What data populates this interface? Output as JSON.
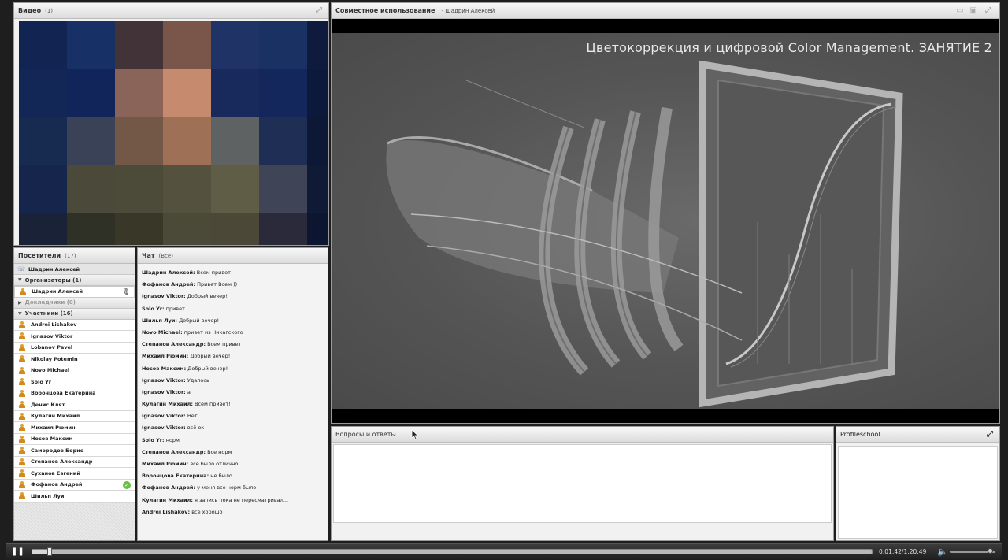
{
  "video": {
    "title": "Видео",
    "count": "(1)",
    "pixels": [
      [
        "#112452",
        "#173066",
        "#413338",
        "#79554a",
        "#1f3366",
        "#1a3163",
        "#0f1b3c"
      ],
      [
        "#132757",
        "#12255a",
        "#8a6458",
        "#c68a6f",
        "#18295b",
        "#13275c",
        "#0d193a"
      ],
      [
        "#172a50",
        "#394256",
        "#735848",
        "#9e7156",
        "#5f6262",
        "#1e2e55",
        "#0c1836"
      ],
      [
        "#16254b",
        "#4b4a3a",
        "#4c4b39",
        "#54523f",
        "#5f5d46",
        "#3f4556",
        "#0e1a36"
      ],
      [
        "#1a2237",
        "#2f3127",
        "#383728",
        "#4b4938",
        "#4c4838",
        "#2a2a3a",
        "#0d1630"
      ]
    ]
  },
  "attendees": {
    "title": "Посетители",
    "count": "(17)",
    "presenter": "Шадрин Алексей",
    "groups": {
      "hosts": "Организаторы (1)",
      "presenters": "Докладчики (0)",
      "participants": "Участники (16)"
    },
    "host_name": "Шадрин Алексей",
    "participants": [
      "Andrei Lishakov",
      "Ignasov Viktor",
      "Lobanov Pavel",
      "Nikolay Potemin",
      "Novo Michael",
      "Solo Yr",
      "Воронцова Екатерина",
      "Денис Клят",
      "Кулагин Михаил",
      "Михаил Рюмин",
      "Носов Максим",
      "Самородов Борис",
      "Степанов Александр",
      "Суханов Евгений",
      "Фофанов Андрей",
      "Шильп Луи"
    ]
  },
  "chat": {
    "title": "Чат",
    "scope": "(Все)",
    "messages": [
      {
        "who": "Шадрин Алексей:",
        "text": "Всем привет!"
      },
      {
        "who": "Фофанов Андрей:",
        "text": "Привет Всем ))"
      },
      {
        "who": "Ignasov Viktor:",
        "text": "Добрый вечер!"
      },
      {
        "who": "Solo Yr:",
        "text": "привет"
      },
      {
        "who": "Шильп Луи:",
        "text": "Добрый вечер!"
      },
      {
        "who": "Novo Michael:",
        "text": "привет из Чикагского"
      },
      {
        "who": "Степанов Александр:",
        "text": " Всем привет"
      },
      {
        "who": "Михаил Рюмин:",
        "text": "Добрый вечер!"
      },
      {
        "who": "Носов Максим:",
        "text": "Добрый вечер!"
      },
      {
        "who": "Ignasov Viktor:",
        "text": "Удалось"
      },
      {
        "who": "Ignasov Viktor:",
        "text": "а"
      },
      {
        "who": "Кулагин Михаил:",
        "text": "Всем привет!"
      },
      {
        "who": "Ignasov Viktor:",
        "text": "Нет"
      },
      {
        "who": "Ignasov Viktor:",
        "text": "всё ок"
      },
      {
        "who": "Solo Yr:",
        "text": "норм"
      },
      {
        "who": "Степанов Александр:",
        "text": "Все норм"
      },
      {
        "who": "Михаил Рюмин:",
        "text": "всё было отлично"
      },
      {
        "who": "Воронцова Екатерина:",
        "text": "не было"
      },
      {
        "who": "Фофанов Андрей:",
        "text": "у меня все норм было"
      },
      {
        "who": "Кулагин Михаил:",
        "text": "я запись пока не пересматривал..."
      },
      {
        "who": "Andrei Lishakov:",
        "text": "все хорошо"
      }
    ]
  },
  "share": {
    "title": "Совместное использование",
    "presenter": "- Шадрин Алексей",
    "slide_title": "Цветокоррекция и цифровой Color Management. ЗАНЯТИЕ 2"
  },
  "qa": {
    "title": "Вопросы и ответы"
  },
  "profile": {
    "title": "Profileschool"
  },
  "playback": {
    "time": "0:01:42/1:20:49",
    "progress": 0.021,
    "volume": 0.9,
    "pause_icon": "pause-icon"
  },
  "colors": {
    "pod_bg": "#f1f1f1",
    "app_bg": "#1e1e1e",
    "check": "#6bbf47"
  }
}
